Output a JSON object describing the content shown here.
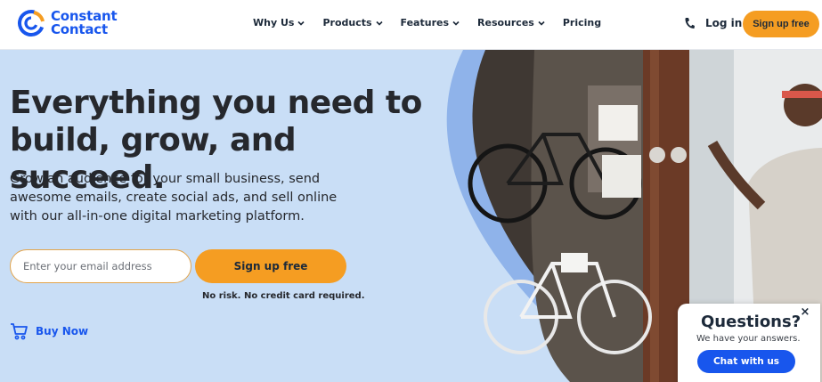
{
  "brand": {
    "name_line1": "Constant",
    "name_line2": "Contact",
    "logo_icon": "constant-contact-logo-icon",
    "color": "#1856ed"
  },
  "nav": {
    "items": [
      {
        "label": "Why Us",
        "has_dropdown": true
      },
      {
        "label": "Products",
        "has_dropdown": true
      },
      {
        "label": "Features",
        "has_dropdown": true
      },
      {
        "label": "Resources",
        "has_dropdown": true
      },
      {
        "label": "Pricing",
        "has_dropdown": false
      }
    ],
    "phone_icon": "phone-icon",
    "login_label": "Log in",
    "signup_label": "Sign up free"
  },
  "hero": {
    "headline": "Everything you need to build, grow, and succeed.",
    "subcopy": "Grow an audience for your small business, send awesome emails, create social ads, and sell online with our all-in-one digital marketing platform.",
    "email_placeholder": "Enter your email address",
    "signup_label": "Sign up free",
    "no_risk": "No risk. No credit card required.",
    "buy_now_label": "Buy Now",
    "buy_now_icon": "cart-icon",
    "bg_color": "#c9def6",
    "accent_color": "#f59d22"
  },
  "chat": {
    "title": "Questions?",
    "subtitle": "We have your answers.",
    "button_label": "Chat with us",
    "close_icon": "close-icon"
  }
}
